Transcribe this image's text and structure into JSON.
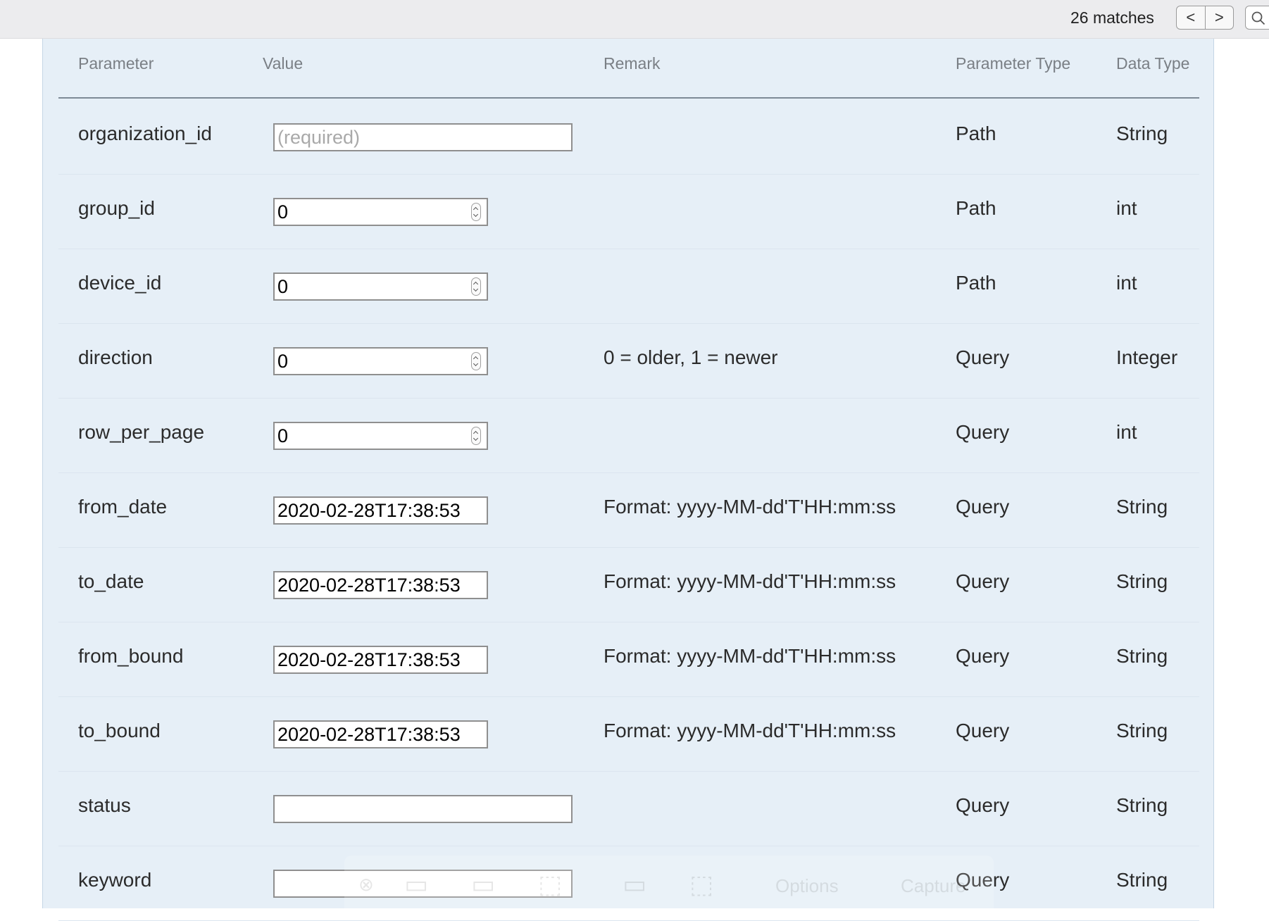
{
  "findbar": {
    "matches_text": "26 matches",
    "prev_label": "<",
    "next_label": ">",
    "search_icon": "magnifier-icon"
  },
  "table": {
    "headers": {
      "parameter": "Parameter",
      "value": "Value",
      "remark": "Remark",
      "parameter_type": "Parameter Type",
      "data_type": "Data Type"
    },
    "rows": [
      {
        "name": "organization_id",
        "value": "",
        "placeholder": "(required)",
        "input": "text-wide",
        "remark": "",
        "ptype": "Path",
        "dtype": "String"
      },
      {
        "name": "group_id",
        "value": "0",
        "input": "number",
        "remark": "",
        "ptype": "Path",
        "dtype": "int"
      },
      {
        "name": "device_id",
        "value": "0",
        "input": "number",
        "remark": "",
        "ptype": "Path",
        "dtype": "int"
      },
      {
        "name": "direction",
        "value": "0",
        "input": "number",
        "remark": "0 = older, 1 = newer",
        "ptype": "Query",
        "dtype": "Integer"
      },
      {
        "name": "row_per_page",
        "value": "0",
        "input": "number",
        "remark": "",
        "ptype": "Query",
        "dtype": "int"
      },
      {
        "name": "from_date",
        "value": "2020-02-28T17:38:53",
        "input": "text-narrow",
        "remark": "Format: yyyy-MM-dd'T'HH:mm:ss",
        "ptype": "Query",
        "dtype": "String"
      },
      {
        "name": "to_date",
        "value": "2020-02-28T17:38:53",
        "input": "text-narrow",
        "remark": "Format: yyyy-MM-dd'T'HH:mm:ss",
        "ptype": "Query",
        "dtype": "String"
      },
      {
        "name": "from_bound",
        "value": "2020-02-28T17:38:53",
        "input": "text-narrow",
        "remark": "Format: yyyy-MM-dd'T'HH:mm:ss",
        "ptype": "Query",
        "dtype": "String"
      },
      {
        "name": "to_bound",
        "value": "2020-02-28T17:38:53",
        "input": "text-narrow",
        "remark": "Format: yyyy-MM-dd'T'HH:mm:ss",
        "ptype": "Query",
        "dtype": "String"
      },
      {
        "name": "status",
        "value": "",
        "input": "text-wide",
        "remark": "",
        "ptype": "Query",
        "dtype": "String"
      },
      {
        "name": "keyword",
        "value": "",
        "input": "text-wide",
        "remark": "",
        "ptype": "Query",
        "dtype": "String"
      }
    ]
  },
  "capture_toolbar": {
    "options_label": "Options",
    "capture_label": "Capture"
  }
}
